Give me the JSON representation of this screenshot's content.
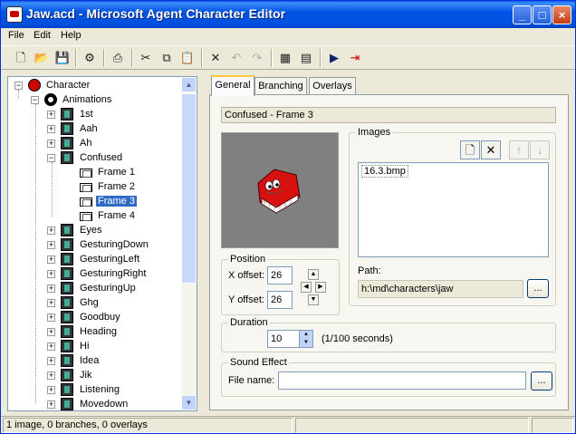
{
  "window": {
    "title": "Jaw.acd - Microsoft Agent Character Editor"
  },
  "menu": {
    "file": "File",
    "edit": "Edit",
    "help": "Help"
  },
  "tree": {
    "root": "Character",
    "animations": "Animations",
    "items": [
      "1st",
      "Aah",
      "Ah",
      "Confused",
      "Eyes",
      "GesturingDown",
      "GesturingLeft",
      "GesturingRight",
      "GesturingUp",
      "Ghg",
      "Goodbuy",
      "Heading",
      "Hi",
      "Idea",
      "Jik",
      "Listening",
      "Movedown"
    ],
    "frames": [
      "Frame 1",
      "Frame 2",
      "Frame 3",
      "Frame 4"
    ],
    "selected": "Frame 3"
  },
  "tabs": [
    "General",
    "Branching",
    "Overlays"
  ],
  "frame_caption": "Confused - Frame 3",
  "position": {
    "title": "Position",
    "x_label": "X offset:",
    "x_value": "26",
    "y_label": "Y offset:",
    "y_value": "26"
  },
  "images": {
    "title": "Images",
    "list": [
      "16.3.bmp"
    ],
    "path_label": "Path:",
    "path_value": "h:\\md\\characters\\jaw",
    "browse": "..."
  },
  "duration": {
    "title": "Duration",
    "value": "10",
    "unit": "(1/100 seconds)"
  },
  "sound": {
    "title": "Sound Effect",
    "file_label": "File name:",
    "file_value": "",
    "browse": "..."
  },
  "status": {
    "text": "1 image, 0 branches, 0 overlays"
  }
}
